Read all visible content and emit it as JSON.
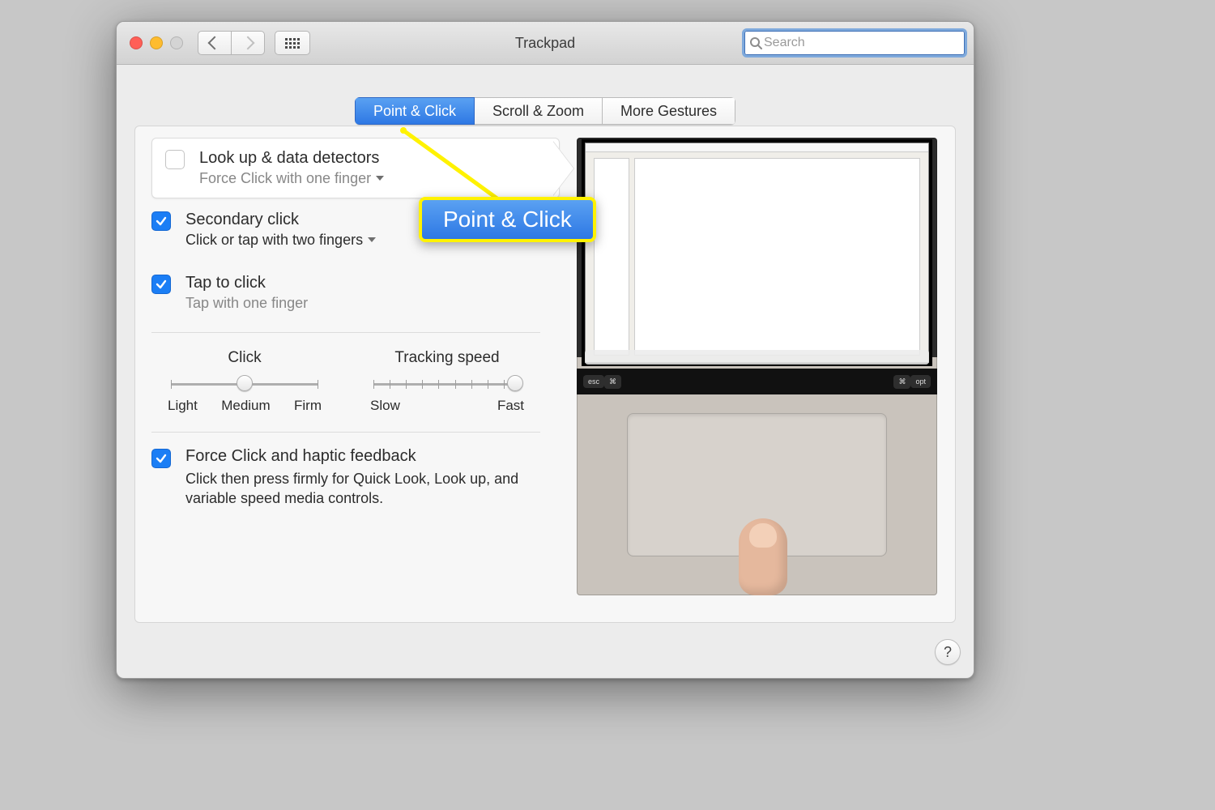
{
  "window": {
    "title": "Trackpad"
  },
  "search": {
    "placeholder": "Search"
  },
  "tabs": {
    "point_click": "Point & Click",
    "scroll_zoom": "Scroll & Zoom",
    "more_gestures": "More Gestures"
  },
  "callout": {
    "label": "Point & Click"
  },
  "options": {
    "look_up": {
      "title": "Look up & data detectors",
      "subtitle": "Force Click with one finger",
      "checked": false
    },
    "secondary_click": {
      "title": "Secondary click",
      "subtitle": "Click or tap with two fingers",
      "checked": true
    },
    "tap_to_click": {
      "title": "Tap to click",
      "subtitle": "Tap with one finger",
      "checked": true
    },
    "force_click": {
      "title": "Force Click and haptic feedback",
      "desc": "Click then press firmly for Quick Look, Look up, and variable speed media controls.",
      "checked": true
    }
  },
  "sliders": {
    "click": {
      "label": "Click",
      "min_label": "Light",
      "mid_label": "Medium",
      "max_label": "Firm",
      "ticks": 3,
      "value_pct": 50
    },
    "tracking": {
      "label": "Tracking speed",
      "min_label": "Slow",
      "max_label": "Fast",
      "ticks": 10,
      "value_pct": 96
    }
  },
  "help": {
    "label": "?"
  },
  "colors": {
    "accent": "#1b7ef5",
    "highlight": "#fff200"
  }
}
